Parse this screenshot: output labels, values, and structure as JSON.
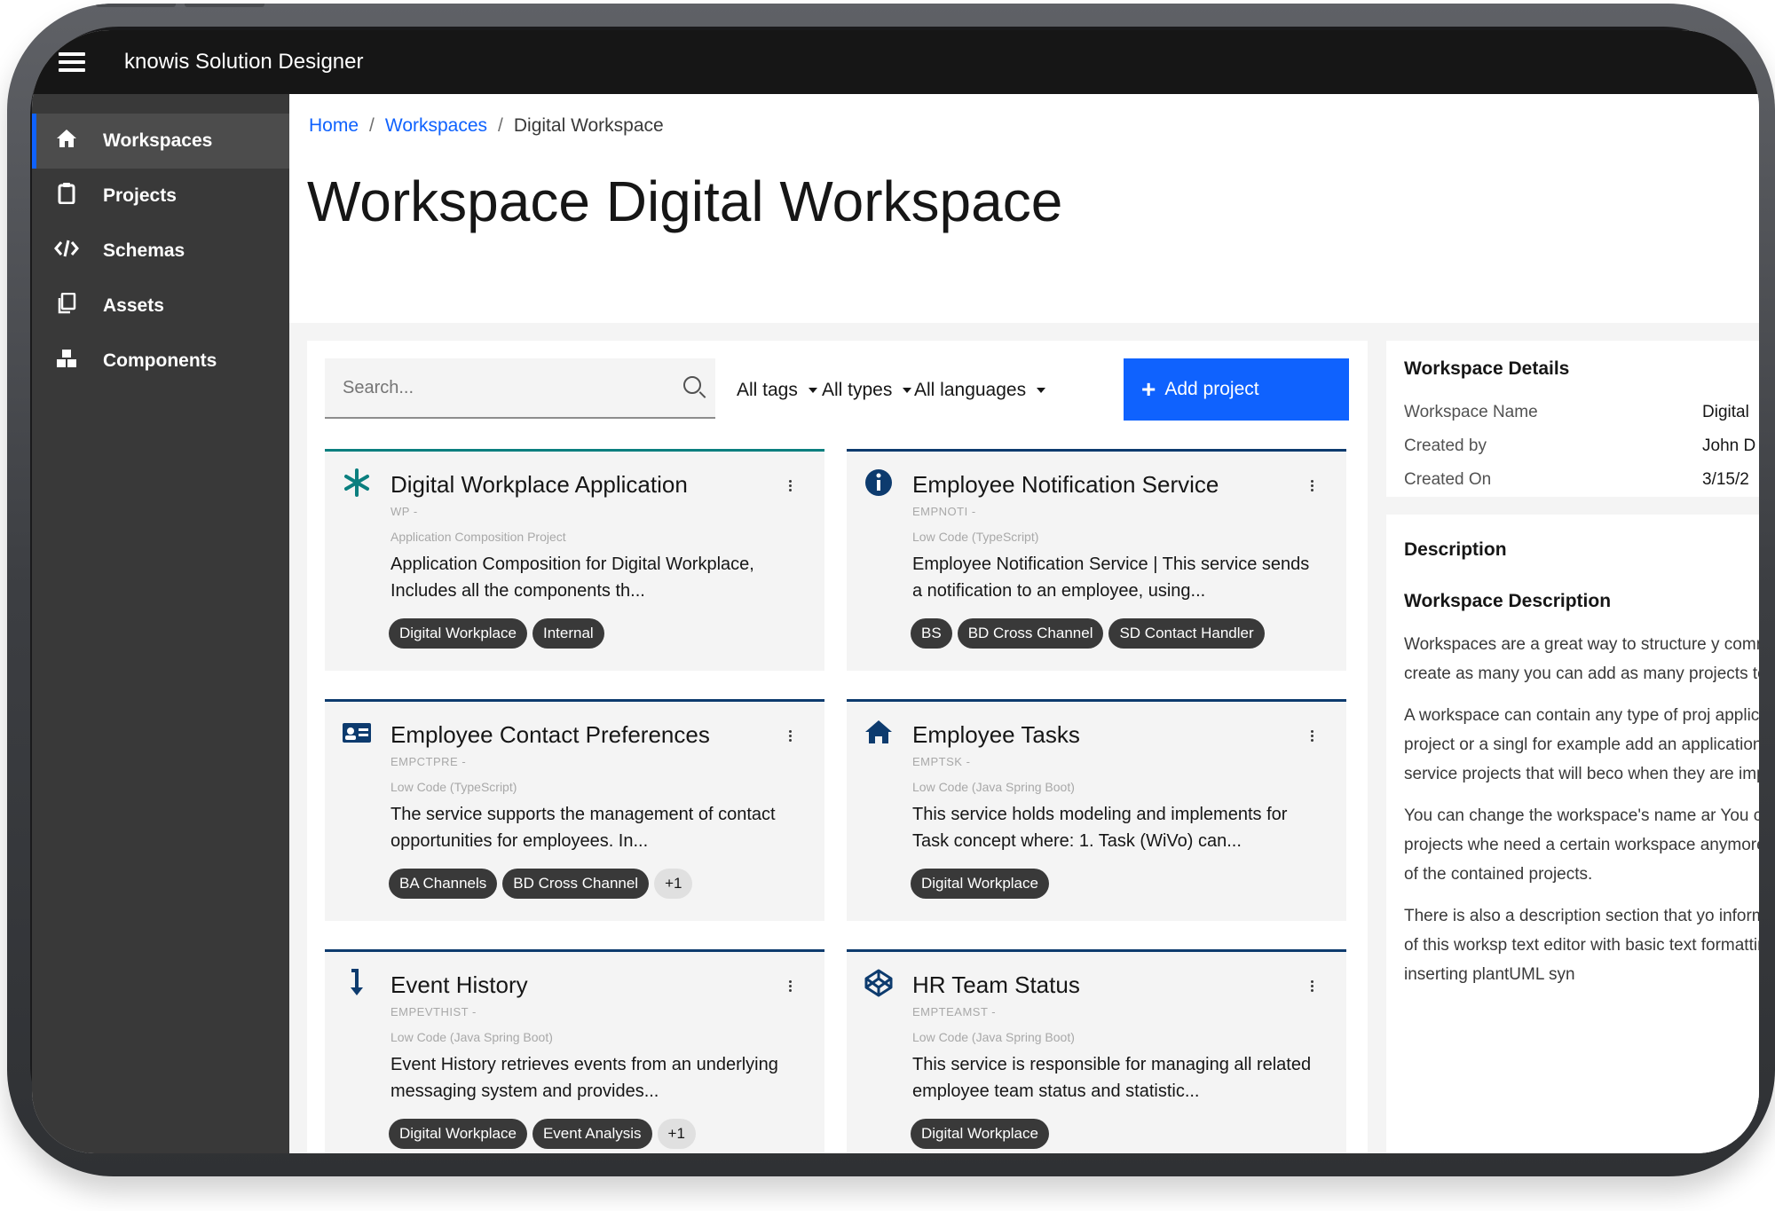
{
  "app": {
    "title": "knowis Solution Designer"
  },
  "sidebar": {
    "items": [
      {
        "label": "Workspaces",
        "icon": "home-icon"
      },
      {
        "label": "Projects",
        "icon": "clipboard-icon"
      },
      {
        "label": "Schemas",
        "icon": "code-icon"
      },
      {
        "label": "Assets",
        "icon": "copy-icon"
      },
      {
        "label": "Components",
        "icon": "cubes-icon"
      }
    ]
  },
  "breadcrumb": {
    "home": "Home",
    "workspaces": "Workspaces",
    "current": "Digital Workspace"
  },
  "page": {
    "title_prefix": "Workspace",
    "title_name": "Digital Workspace"
  },
  "toolbar": {
    "search_placeholder": "Search...",
    "filter_tags": "All tags",
    "filter_types": "All types",
    "filter_languages": "All languages",
    "add_project": "Add project"
  },
  "projects": [
    {
      "title": "Digital Workplace Application",
      "code": "WP -",
      "type": "Application Composition Project",
      "desc": "Application Composition for Digital Workplace, Includes all the components th...",
      "tags": [
        "Digital Workplace",
        "Internal"
      ],
      "icon": "asterisk-icon"
    },
    {
      "title": "Employee Notification Service",
      "code": "EMPNOTI -",
      "type": "Low Code (TypeScript)",
      "desc": "Employee Notification Service | This service sends a notification to an employee, using...",
      "tags": [
        "BS",
        "BD Cross Channel",
        "SD Contact Handler"
      ],
      "icon": "info-icon"
    },
    {
      "title": "Employee Contact Preferences",
      "code": "EMPCTPRE -",
      "type": "Low Code (TypeScript)",
      "desc": "The service supports the management of contact opportunities for employees. In...",
      "tags": [
        "BA Channels",
        "BD Cross Channel"
      ],
      "more": "+1",
      "icon": "id-card-icon"
    },
    {
      "title": "Employee Tasks",
      "code": "EMPTSK -",
      "type": "Low Code (Java Spring Boot)",
      "desc": "This service holds modeling and implements for Task concept where: 1. Task (WiVo) can...",
      "tags": [
        "Digital Workplace"
      ],
      "icon": "home-icon"
    },
    {
      "title": "Event History",
      "code": "EMPEVTHIST -",
      "type": "Low Code (Java Spring Boot)",
      "desc": "Event History retrieves events from an underlying messaging system and provides...",
      "tags": [
        "Digital Workplace",
        "Event Analysis"
      ],
      "more": "+1",
      "icon": "arrow-down-icon"
    },
    {
      "title": "HR Team Status",
      "code": "EMPTEAMST -",
      "type": "Low Code (Java Spring Boot)",
      "desc": "This service is responsible for managing all related employee team status and statistic...",
      "tags": [
        "Digital Workplace"
      ],
      "icon": "codepen-icon"
    }
  ],
  "details": {
    "heading": "Workspace Details",
    "rows": [
      {
        "label": "Workspace Name",
        "value": "Digital"
      },
      {
        "label": "Created by",
        "value": "John D"
      },
      {
        "label": "Created On",
        "value": "3/15/2"
      }
    ]
  },
  "description": {
    "heading": "Description",
    "subtitle": "Workspace Description",
    "paragraphs": [
      "Workspaces are a great way to structure y common context. You can create as many you can add as many projects to a worksp",
      "A workspace can contain any type of proj application composition project or a singl for example add an application compositi and all the service projects that will beco when they are implemented.",
      "You can change the workspace's name ar You can also add or remove projects whe need a certain workspace anymore you ca affecting any of the contained projects.",
      "There is also a description section that yo information on the purpose of this worksp text editor with basic text formatting an diagrams by inserting plantUML syn"
    ]
  },
  "colors": {
    "accent": "#0f62fe",
    "topbar": "#161616",
    "sidebar": "#393939",
    "tag": "#393939"
  }
}
